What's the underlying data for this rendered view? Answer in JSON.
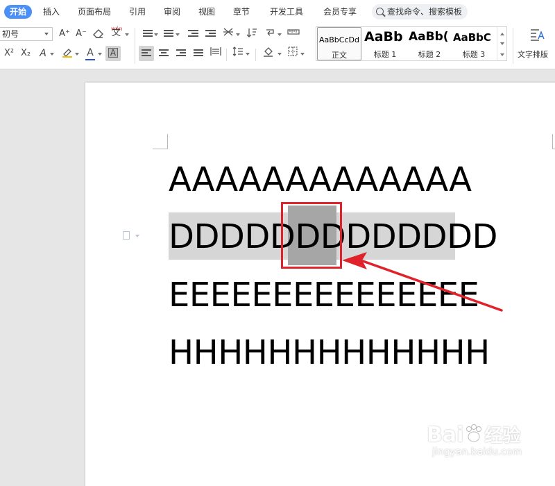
{
  "tabs": {
    "start": "开始",
    "insert": "插入",
    "page_layout": "页面布局",
    "references": "引用",
    "review": "审阅",
    "view": "视图",
    "chapter": "章节",
    "developer": "开发工具",
    "member": "会员专享"
  },
  "search": {
    "placeholder": "查找命令、搜索模板",
    "icon": "search-icon"
  },
  "toolbar": {
    "font_size_value": "初号",
    "grow_font": "A⁺",
    "shrink_font": "A⁻",
    "clear_format_icon": "eraser-icon",
    "phonetic_label": "wén",
    "phonetic_char": "文",
    "superscript": "X²",
    "subscript": "X₂",
    "text_effect": "A",
    "font_color_letter": "A",
    "char_shading_letter": "A",
    "accent_color": "#4a90f7",
    "font_color": "#2a4fd6"
  },
  "styles": [
    {
      "sample": "AaBbCcDd",
      "name": "正文"
    },
    {
      "sample": "AaBb",
      "name": "标题 1"
    },
    {
      "sample": "AaBb(",
      "name": "标题 2"
    },
    {
      "sample": "AaBbC",
      "name": "标题 3"
    }
  ],
  "text_layout": {
    "label": "文字排版"
  },
  "document": {
    "lines": [
      "AAAAAAAAAAAAA",
      "DDDDDDDDDDDDD",
      "EEEEEEEEEEEEEEE",
      "HHHHHHHHHHHHH"
    ],
    "line2_before": "DDDDD",
    "line2_selected": "DD",
    "line2_after": "DDDDDD",
    "highlight_color": "#d6d6d6",
    "selection_color": "#a6a6a6",
    "annotation_color": "#e0232b"
  },
  "watermark": {
    "brand": "Bai",
    "brand_suffix": "经验",
    "url": "jingyan.baidu.com"
  }
}
